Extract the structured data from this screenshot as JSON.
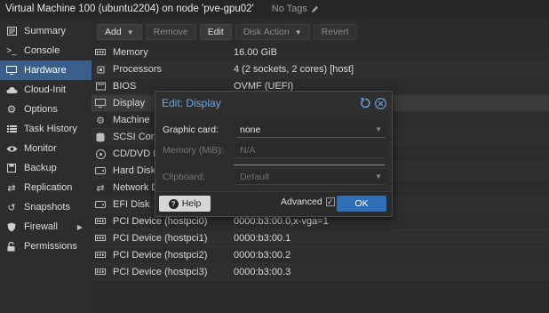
{
  "header": {
    "title": "Virtual Machine 100 (ubuntu2204) on node 'pve-gpu02'",
    "tags": "No Tags"
  },
  "sidebar": {
    "items": [
      {
        "label": "Summary",
        "icon": "summary-icon"
      },
      {
        "label": "Console",
        "icon": "console-icon"
      },
      {
        "label": "Hardware",
        "icon": "monitor-icon",
        "active": true
      },
      {
        "label": "Cloud-Init",
        "icon": "cloud-icon"
      },
      {
        "label": "Options",
        "icon": "gear-icon"
      },
      {
        "label": "Task History",
        "icon": "list-icon"
      },
      {
        "label": "Monitor",
        "icon": "eye-icon"
      },
      {
        "label": "Backup",
        "icon": "floppy-icon"
      },
      {
        "label": "Replication",
        "icon": "retweet-icon"
      },
      {
        "label": "Snapshots",
        "icon": "history-icon"
      },
      {
        "label": "Firewall",
        "icon": "shield-icon"
      },
      {
        "label": "Permissions",
        "icon": "unlock-icon"
      }
    ]
  },
  "toolbar": {
    "add": "Add",
    "remove": "Remove",
    "edit": "Edit",
    "disk_action": "Disk Action",
    "revert": "Revert"
  },
  "hardware": [
    {
      "name": "Memory",
      "value": "16.00 GiB",
      "icon": "memory-icon"
    },
    {
      "name": "Processors",
      "value": "4 (2 sockets, 2 cores) [host]",
      "icon": "cpu-icon"
    },
    {
      "name": "BIOS",
      "value": "OVMF (UEFI)",
      "icon": "chip-icon"
    },
    {
      "name": "Display",
      "value": "",
      "icon": "desktop-icon"
    },
    {
      "name": "Machine",
      "value": "",
      "icon": "cogs-icon"
    },
    {
      "name": "SCSI Contr",
      "value": "",
      "icon": "database-icon"
    },
    {
      "name": "CD/DVD D",
      "value": "",
      "icon": "cdrom-icon"
    },
    {
      "name": "Hard Disk",
      "value": "),discard=on,iothread=1,size=64G",
      "icon": "hdd-icon"
    },
    {
      "name": "Network D",
      "value": "irewall=1",
      "icon": "exchange-icon"
    },
    {
      "name": "EFI Disk",
      "value": "nrolled-keys=1,size=4M",
      "icon": "hdd-icon"
    },
    {
      "name": "PCI Device (hostpci0)",
      "value": "0000:b3:00.0,x-vga=1",
      "icon": "pci-icon"
    },
    {
      "name": "PCI Device (hostpci1)",
      "value": "0000:b3:00.1",
      "icon": "pci-icon"
    },
    {
      "name": "PCI Device (hostpci2)",
      "value": "0000:b3:00.2",
      "icon": "pci-icon"
    },
    {
      "name": "PCI Device (hostpci3)",
      "value": "0000:b3:00.3",
      "icon": "pci-icon"
    }
  ],
  "dialog": {
    "title": "Edit: Display",
    "graphic_card_label": "Graphic card:",
    "graphic_card_value": "none",
    "memory_label": "Memory (MiB):",
    "memory_value": "N/A",
    "clipboard_label": "Clipboard:",
    "clipboard_value": "Default",
    "help": "Help",
    "advanced": "Advanced",
    "ok": "OK"
  }
}
